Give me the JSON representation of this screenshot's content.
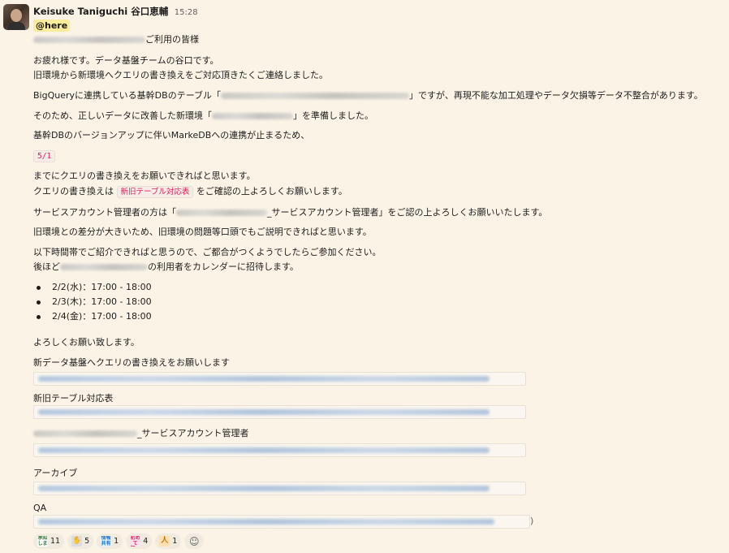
{
  "message": {
    "sender": "Keisuke Taniguchi 谷口恵輔",
    "time": "15:28",
    "mention": "@here",
    "greeting_suffix": "ご利用の皆様",
    "intro1": "お疲れ様です。データ基盤チームの谷口です。",
    "intro2": "旧環境から新環境へクエリの書き換えをご対応頂きたくご連絡しました。",
    "bq_prefix": "BigQueryに連携している基幹DBのテーブル「",
    "bq_suffix": "」ですが、再現不能な加工処理やデータ欠損等データ不整合があります。",
    "fixed_prefix": "そのため、正しいデータに改善した新環境「",
    "fixed_suffix": "」を準備しました。",
    "version_note": "基幹DBのバージョンアップに伴いMarkeDBへの連携が止まるため、",
    "deadline": "5/1",
    "deadline_note": "までにクエリの書き換えをお願いできればと思います。",
    "rewrite_prefix": "クエリの書き換えは ",
    "rewrite_tag": "新旧テーブル対応表",
    "rewrite_suffix": " をご確認の上よろしくお願いします。",
    "sa_prefix": "サービスアカウント管理者の方は「",
    "sa_suffix": "_サービスアカウント管理者」をご認の上よろしくお願いいたします。",
    "diff_note": "旧環境との差分が大きいため、旧環境の問題等口頭でもご説明できればと思います。",
    "schedule_intro": "以下時間帯でご紹介できればと思うので、ご都合がつくようでしたらご参加ください。",
    "invite_prefix": "後ほど",
    "invite_suffix": "の利用者をカレンダーに招待します。",
    "slots": [
      "2/2(水)：17:00 - 18:00",
      "2/3(木)：17:00 - 18:00",
      "2/4(金)：17:00 - 18:00"
    ],
    "closing": "よろしくお願い致します。",
    "links": [
      {
        "title": "新データ基盤へクエリの書き換えをお願いします"
      },
      {
        "title": "新旧テーブル対応表"
      },
      {
        "title": "_サービスアカウント管理者"
      },
      {
        "title": "アーカイブ"
      },
      {
        "title": "QA"
      }
    ],
    "qa_close": ")"
  },
  "reactions": [
    {
      "emoji": "承知しました",
      "count": "11",
      "color": "#2f7d32"
    },
    {
      "emoji": "ok-hand",
      "count": "5",
      "color": "#8e8e8e"
    },
    {
      "emoji": "情報共有",
      "count": "1",
      "color": "#1976d2"
    },
    {
      "emoji": "初めて知った",
      "count": "4",
      "color": "#e91e63"
    },
    {
      "emoji": "pray",
      "count": "1",
      "color": "#c77700"
    }
  ],
  "add_reaction_icon": "add-emoji-icon"
}
